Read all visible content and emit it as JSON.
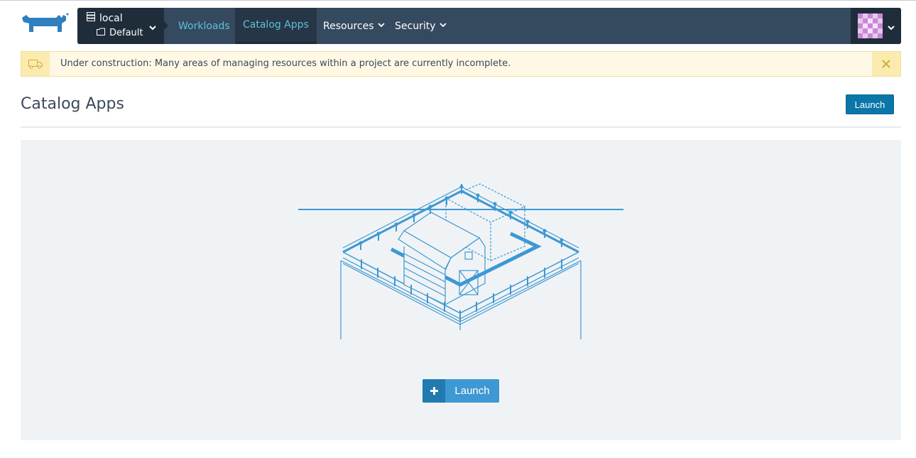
{
  "nav": {
    "cluster": "local",
    "project": "Default",
    "items": [
      {
        "label": "Workloads"
      },
      {
        "label": "Catalog Apps"
      },
      {
        "label": "Resources"
      },
      {
        "label": "Security"
      }
    ]
  },
  "banner": {
    "text": "Under construction: Many areas of managing resources within a project are currently incomplete."
  },
  "page": {
    "title": "Catalog Apps",
    "launch_label": "Launch"
  },
  "empty_state": {
    "launch_label": "Launch"
  },
  "colors": {
    "nav_bg": "#35495f",
    "nav_dark": "#1f2d3b",
    "accent": "#0b76a8",
    "link": "#5cc1d9",
    "banner_bg": "#fef8e4",
    "illustration": "#3d98d3"
  },
  "icons": [
    "rancher-logo-icon",
    "server-icon",
    "folder-icon",
    "chevron-down-icon",
    "truck-icon",
    "close-icon",
    "plus-icon"
  ]
}
